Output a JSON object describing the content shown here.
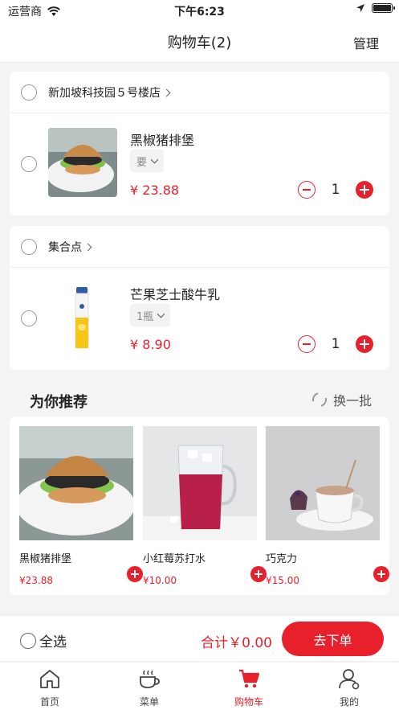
{
  "status_bar": {
    "carrier": "运营商",
    "time": "下午6:23"
  },
  "nav": {
    "title": "购物车(2)",
    "manage": "管理"
  },
  "stores": [
    {
      "name": "新加坡科技园５号楼店",
      "items": [
        {
          "name": "黑椒猪排堡",
          "spec": "要",
          "price": "¥ 23.88",
          "qty": "1"
        }
      ]
    },
    {
      "name": "集合点",
      "items": [
        {
          "name": "芒果芝士酸牛乳",
          "spec": "1瓶",
          "price": "¥ 8.90",
          "qty": "1"
        }
      ]
    }
  ],
  "recommend": {
    "title": "为你推荐",
    "refresh": "换一批",
    "items": [
      {
        "name": "黑椒猪排堡",
        "price": "¥23.88"
      },
      {
        "name": "小红莓苏打水",
        "price": "¥10.00"
      },
      {
        "name": "巧克力",
        "price": "¥15.00"
      }
    ]
  },
  "checkout": {
    "select_all": "全选",
    "total": "合计￥0.00",
    "button": "去下单"
  },
  "tabs": [
    {
      "label": "首页",
      "icon": "home-icon"
    },
    {
      "label": "菜单",
      "icon": "coffee-cup-icon"
    },
    {
      "label": "购物车",
      "icon": "cart-icon",
      "active": true
    },
    {
      "label": "我的",
      "icon": "user-icon"
    }
  ],
  "colors": {
    "accent": "#e8202c",
    "background": "#f4f4f4"
  }
}
